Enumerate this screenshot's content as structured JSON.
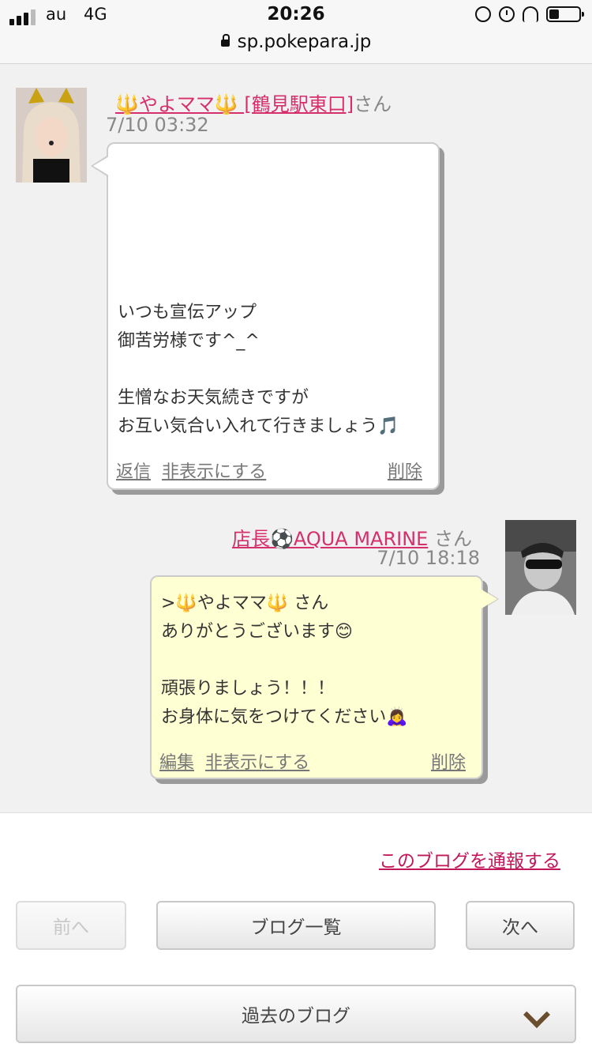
{
  "status_bar": {
    "carrier": "au",
    "network": "4G",
    "time": "20:26",
    "url": "sp.pokepara.jp",
    "icons": [
      "signal-icon",
      "rotation-lock-icon",
      "alarm-icon",
      "headphones-icon",
      "battery-icon"
    ]
  },
  "comments": [
    {
      "name": "🔱やよママ🔱 [鶴見駅東口]",
      "san": "さん",
      "date": "7/10 03:32",
      "body": "いつも宣伝アップ\n御苦労様です^_^\n\n生憎なお天気続きですが\nお互い気合い入れて行きましょう🎵",
      "actions": {
        "reply": "返信",
        "hide": "非表示にする",
        "delete": "削除"
      }
    },
    {
      "name": "店長⚽AQUA MARINE",
      "san": "さん",
      "date": "7/10 18:18",
      "body": ">🔱やよママ🔱 さん\nありがとうございます😊\n\n頑張りましょう！！！\nお身体に気をつけてください🙇‍♀️",
      "actions": {
        "edit": "編集",
        "hide": "非表示にする",
        "delete": "削除"
      }
    }
  ],
  "footer": {
    "report": "このブログを通報する",
    "prev": "前へ",
    "list": "ブログ一覧",
    "next": "次へ",
    "past": "過去のブログ"
  },
  "colors": {
    "link_pink": "#d6306c",
    "report_link": "#c2185b",
    "reply_bubble": "#ffffd4"
  }
}
